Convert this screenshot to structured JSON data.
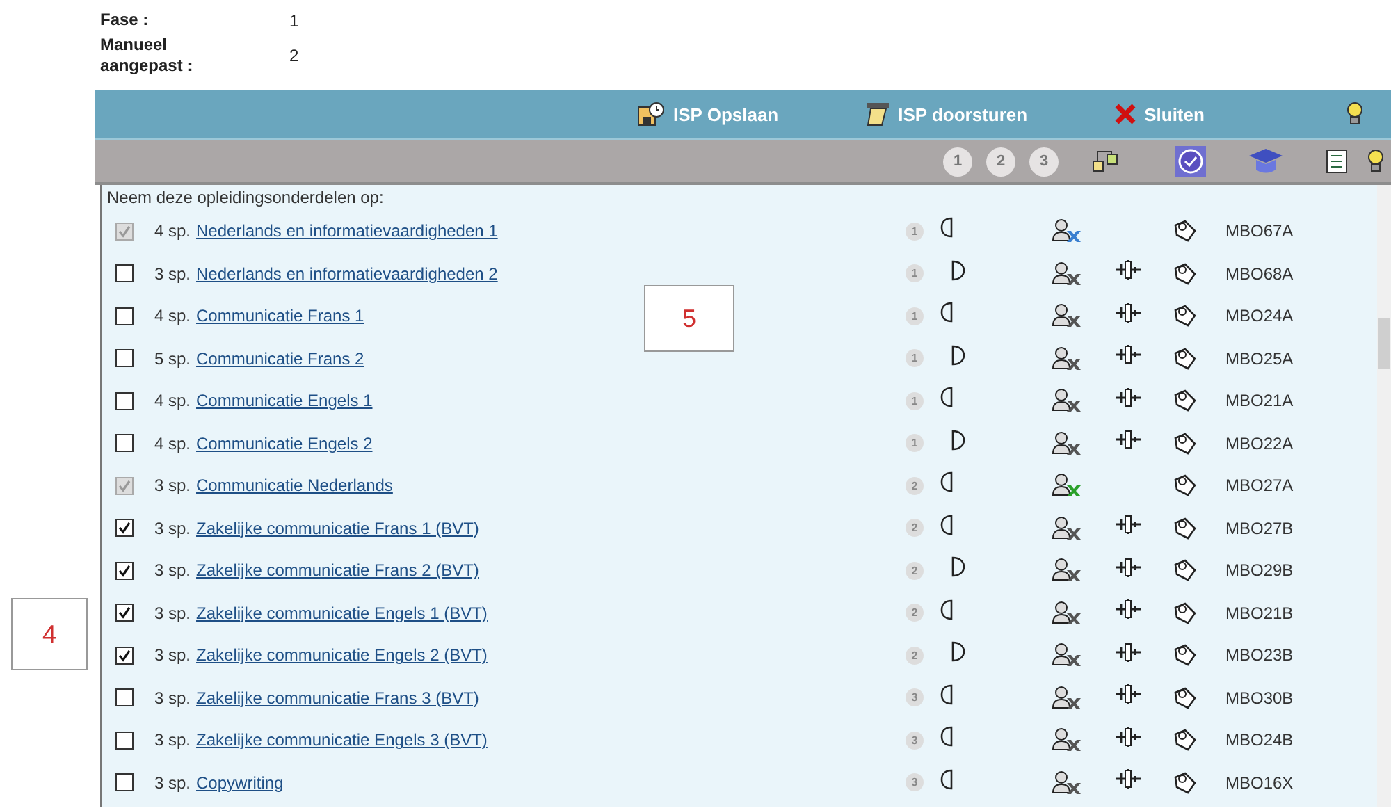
{
  "header_fields": [
    {
      "label": "Fase :",
      "value": "1"
    },
    {
      "label": "Manueel aangepast :",
      "value": "2"
    }
  ],
  "actions": [
    {
      "kind": "save",
      "label": "ISP Opslaan"
    },
    {
      "kind": "forward",
      "label": "ISP doorsturen"
    },
    {
      "kind": "close",
      "label": "Sluiten"
    }
  ],
  "phase_filters": [
    "1",
    "2",
    "3"
  ],
  "intro": "Neem deze opleidingsonderdelen op:",
  "rows": [
    {
      "checked": true,
      "disabled": true,
      "credits": "4 sp.",
      "title": "Nederlands en informatievaardigheden 1",
      "phase": "1",
      "second_half": false,
      "color": "#3a7fd0",
      "exchange": false,
      "code": "MBO67A"
    },
    {
      "checked": false,
      "disabled": false,
      "credits": "3 sp.",
      "title": "Nederlands en informatievaardigheden 2",
      "phase": "1",
      "second_half": true,
      "color": "#555555",
      "exchange": true,
      "code": "MBO68A"
    },
    {
      "checked": false,
      "disabled": false,
      "credits": "4 sp.",
      "title": "Communicatie Frans 1",
      "phase": "1",
      "second_half": false,
      "color": "#555555",
      "exchange": true,
      "code": "MBO24A"
    },
    {
      "checked": false,
      "disabled": false,
      "credits": "5 sp.",
      "title": "Communicatie Frans 2",
      "phase": "1",
      "second_half": true,
      "color": "#555555",
      "exchange": true,
      "code": "MBO25A"
    },
    {
      "checked": false,
      "disabled": false,
      "credits": "4 sp.",
      "title": "Communicatie Engels 1",
      "phase": "1",
      "second_half": false,
      "color": "#555555",
      "exchange": true,
      "code": "MBO21A"
    },
    {
      "checked": false,
      "disabled": false,
      "credits": "4 sp.",
      "title": "Communicatie Engels 2",
      "phase": "1",
      "second_half": true,
      "color": "#555555",
      "exchange": true,
      "code": "MBO22A"
    },
    {
      "checked": true,
      "disabled": true,
      "credits": "3 sp.",
      "title": "Communicatie Nederlands",
      "phase": "2",
      "second_half": false,
      "color": "#2aa02a",
      "exchange": false,
      "code": "MBO27A"
    },
    {
      "checked": true,
      "disabled": false,
      "credits": "3 sp.",
      "title": "Zakelijke communicatie Frans 1 (BVT)",
      "phase": "2",
      "second_half": false,
      "color": "#555555",
      "exchange": true,
      "code": "MBO27B"
    },
    {
      "checked": true,
      "disabled": false,
      "credits": "3 sp.",
      "title": "Zakelijke communicatie Frans 2 (BVT)",
      "phase": "2",
      "second_half": true,
      "color": "#555555",
      "exchange": true,
      "code": "MBO29B"
    },
    {
      "checked": true,
      "disabled": false,
      "credits": "3 sp.",
      "title": "Zakelijke communicatie Engels 1 (BVT)",
      "phase": "2",
      "second_half": false,
      "color": "#555555",
      "exchange": true,
      "code": "MBO21B"
    },
    {
      "checked": true,
      "disabled": false,
      "credits": "3 sp.",
      "title": "Zakelijke communicatie Engels 2 (BVT)",
      "phase": "2",
      "second_half": true,
      "color": "#555555",
      "exchange": true,
      "code": "MBO23B"
    },
    {
      "checked": false,
      "disabled": false,
      "credits": "3 sp.",
      "title": "Zakelijke communicatie Frans 3 (BVT)",
      "phase": "3",
      "second_half": false,
      "color": "#555555",
      "exchange": true,
      "code": "MBO30B"
    },
    {
      "checked": false,
      "disabled": false,
      "credits": "3 sp.",
      "title": "Zakelijke communicatie Engels 3 (BVT)",
      "phase": "3",
      "second_half": false,
      "color": "#555555",
      "exchange": true,
      "code": "MBO24B"
    },
    {
      "checked": false,
      "disabled": false,
      "credits": "3 sp.",
      "title": "Copywriting",
      "phase": "3",
      "second_half": false,
      "color": "#555555",
      "exchange": true,
      "code": "MBO16X"
    }
  ],
  "annotations": [
    {
      "label": "5"
    },
    {
      "label": "4"
    }
  ]
}
